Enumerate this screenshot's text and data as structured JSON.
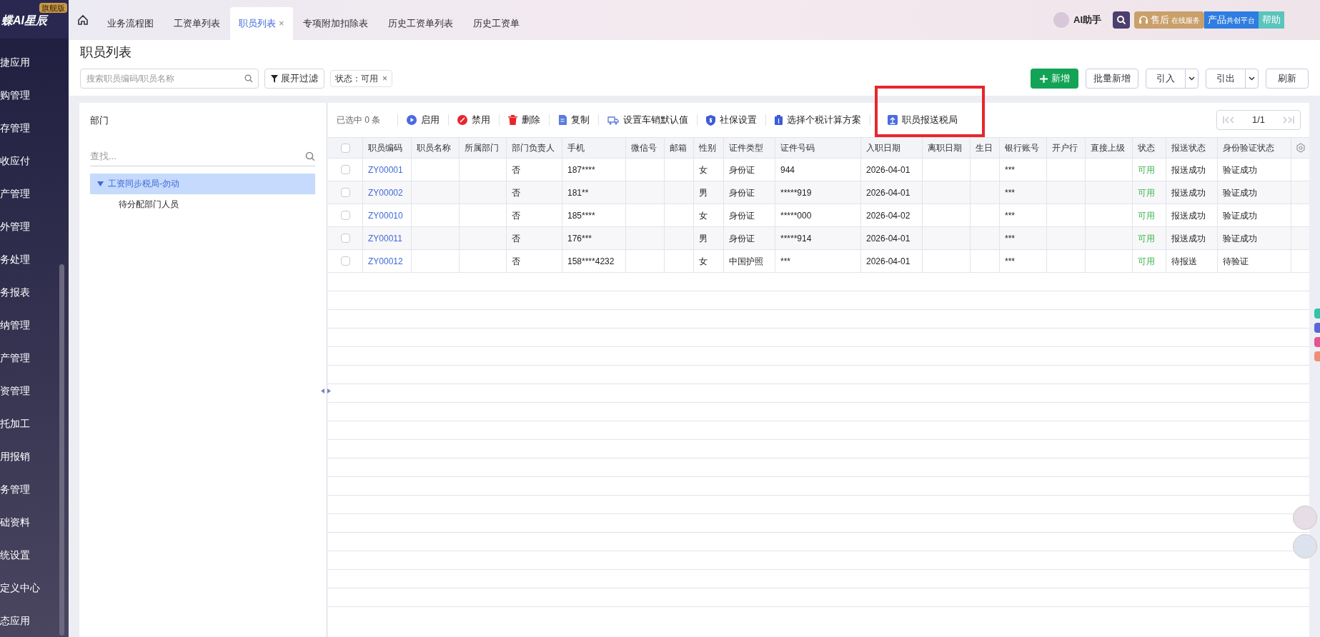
{
  "brand": {
    "name": "蝶AI星辰",
    "badge": "旗舰版"
  },
  "tab_close": "×",
  "chip_close": "×",
  "nav_tabs": [
    {
      "label": "业务流程图",
      "selected": false,
      "closable": false
    },
    {
      "label": "工资单列表",
      "selected": false,
      "closable": false
    },
    {
      "label": "职员列表",
      "selected": true,
      "closable": true
    },
    {
      "label": "专项附加扣除表",
      "selected": false,
      "closable": false
    },
    {
      "label": "历史工资单列表",
      "selected": false,
      "closable": false
    },
    {
      "label": "历史工资单",
      "selected": false,
      "closable": false
    }
  ],
  "header_actions": {
    "assistant": "AI助手",
    "service": "售后",
    "service_sub": "在线服务",
    "platform": "产品",
    "platform_sub": "共创平台",
    "help": "帮助"
  },
  "sidebar": {
    "items": [
      "捷应用",
      "购管理",
      "存管理",
      "收应付",
      "产管理",
      "外管理",
      "务处理",
      "务报表",
      "纳管理",
      "产管理",
      "资管理",
      "托加工",
      "用报销",
      "务管理",
      "础资料",
      "统设置",
      "定义中心",
      "态应用"
    ]
  },
  "page_title": "职员列表",
  "filters": {
    "search_placeholder": "搜索职员编码/职员名称",
    "expand": "展开过滤",
    "chip": "状态：可用"
  },
  "actions": [
    {
      "label": "新增",
      "kind": "primary"
    },
    {
      "label": "批量新增",
      "kind": "plain"
    },
    {
      "label": "引入",
      "kind": "split"
    },
    {
      "label": "引出",
      "kind": "split"
    },
    {
      "label": "刷新",
      "kind": "plain"
    }
  ],
  "departments": {
    "title": "部门",
    "search_placeholder": "查找...",
    "tree": [
      {
        "label": "工资同步税局-勿动",
        "expanded": true,
        "selected": true,
        "children": [
          {
            "label": "待分配部门人员",
            "selected": false
          }
        ]
      }
    ]
  },
  "toolbar": {
    "selected_count": "已选中 0 条",
    "buttons": [
      {
        "label": "启用",
        "kind": "play"
      },
      {
        "label": "禁用",
        "kind": "ban"
      },
      {
        "label": "删除",
        "kind": "trash"
      },
      {
        "label": "复制",
        "kind": "doc"
      },
      {
        "label": "设置车销默认值",
        "kind": "truck"
      },
      {
        "label": "社保设置",
        "kind": "shield"
      },
      {
        "label": "选择个税计算方案",
        "kind": "clipboard"
      },
      {
        "label": "职员报送税局",
        "kind": "upload",
        "highlighted": true
      }
    ],
    "pager": "1/1"
  },
  "table": {
    "all_checked": false,
    "columns": [
      "职员编码",
      "职员名称",
      "所属部门",
      "部门负责人",
      "手机",
      "微信号",
      "邮箱",
      "性别",
      "证件类型",
      "证件号码",
      "入职日期",
      "离职日期",
      "生日",
      "银行账号",
      "开户行",
      "直接上级",
      "状态",
      "报送状态",
      "身份验证状态"
    ],
    "rows": [
      {
        "checked": false,
        "cells": [
          "ZY00001",
          "",
          "",
          "否",
          "187****",
          "",
          "",
          "女",
          "身份证",
          "944",
          "2026-04-01",
          "",
          "",
          "***",
          "",
          "",
          "可用",
          "报送成功",
          "验证成功"
        ]
      },
      {
        "checked": false,
        "cells": [
          "ZY00002",
          "",
          "",
          "否",
          "181**",
          "",
          "",
          "男",
          "身份证",
          "*****919",
          "2026-04-01",
          "",
          "",
          "***",
          "",
          "",
          "可用",
          "报送成功",
          "验证成功"
        ]
      },
      {
        "checked": false,
        "cells": [
          "ZY00010",
          "",
          "",
          "否",
          "185****",
          "",
          "",
          "女",
          "身份证",
          "*****000",
          "2026-04-02",
          "",
          "",
          "***",
          "",
          "",
          "可用",
          "报送成功",
          "验证成功"
        ]
      },
      {
        "checked": false,
        "cells": [
          "ZY00011",
          "",
          "",
          "否",
          "176***",
          "",
          "",
          "男",
          "身份证",
          "*****914",
          "2026-04-01",
          "",
          "",
          "***",
          "",
          "",
          "可用",
          "报送成功",
          "验证成功"
        ]
      },
      {
        "checked": false,
        "cells": [
          "ZY00012",
          "",
          "",
          "否",
          "158****4232",
          "",
          "",
          "女",
          "中国护照",
          "***",
          "2026-04-01",
          "",
          "",
          "***",
          "",
          "",
          "可用",
          "待报送",
          "待验证"
        ]
      }
    ]
  }
}
